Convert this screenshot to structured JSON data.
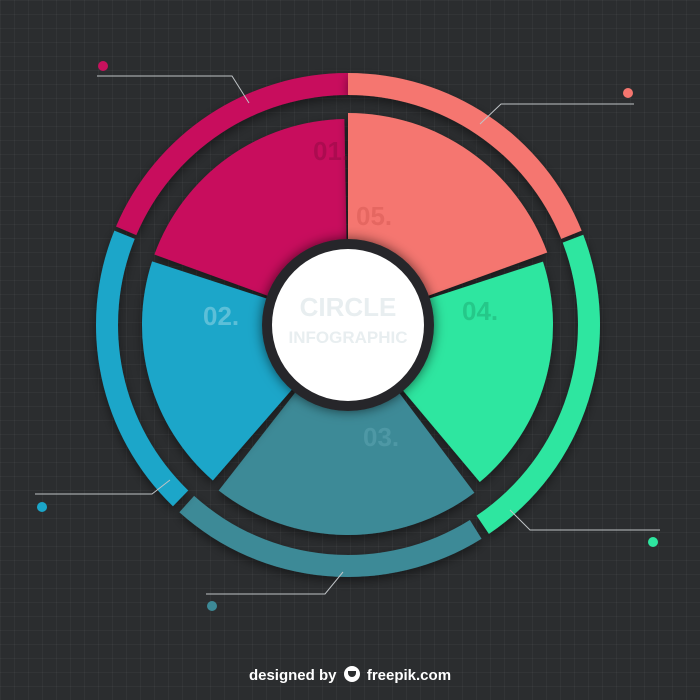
{
  "colors": {
    "magenta": "#c8115d",
    "salmon": "#f5766f",
    "green": "#2ee6a0",
    "teal": "#3d8a97",
    "blue": "#1ba6c9",
    "center": "#ffffff",
    "background": "#2b2d2f"
  },
  "segments": [
    {
      "id": "01",
      "label": "01.",
      "color": "magenta"
    },
    {
      "id": "05",
      "label": "05.",
      "color": "salmon"
    },
    {
      "id": "04",
      "label": "04.",
      "color": "green"
    },
    {
      "id": "03",
      "label": "03.",
      "color": "teal"
    },
    {
      "id": "02",
      "label": "02.",
      "color": "blue"
    }
  ],
  "center": {
    "title": "CIRCLE",
    "subtitle": "INFOGRAPHIC",
    "small": "—  ·  —"
  },
  "footer": {
    "prefix": "designed by",
    "brand": "freepik.com"
  }
}
